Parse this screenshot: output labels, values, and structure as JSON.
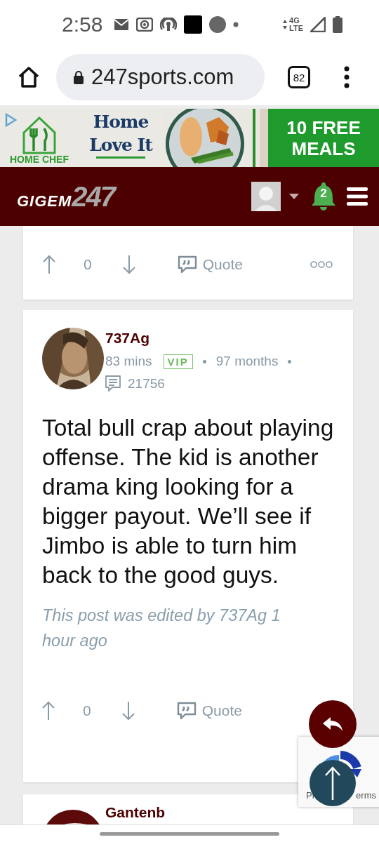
{
  "status_bar": {
    "time": "2:58",
    "network": [
      "4G",
      "LTE"
    ]
  },
  "browser": {
    "url": "247sports.com",
    "tab_count": "82"
  },
  "ad": {
    "brand": "HOME CHEF",
    "headline": [
      "Home",
      "Love It"
    ],
    "offer": [
      "10 FREE",
      "MEALS"
    ]
  },
  "site_header": {
    "logo": [
      "GIGEM",
      "247"
    ],
    "notification_count": "2"
  },
  "posts": [
    {
      "kind": "actions_only",
      "votes": "0",
      "quote_label": "Quote",
      "has_more": true
    },
    {
      "kind": "full",
      "author": "737Ag",
      "time": "83 mins",
      "badge": "VIP",
      "tenure": "97 months",
      "post_count": "21756",
      "body": "Total bull crap about playing offense. The kid is another drama king looking for a bigger payout. We’ll see if Jimbo is able to turn him back to the good guys.",
      "edit_note": "This post was edited by 737Ag 1 hour ago",
      "votes": "0",
      "quote_label": "Quote",
      "has_more": false
    },
    {
      "kind": "header_only",
      "author": "Gantenb"
    }
  ],
  "recaptcha": {
    "left": "Pr",
    "right": "erms"
  }
}
